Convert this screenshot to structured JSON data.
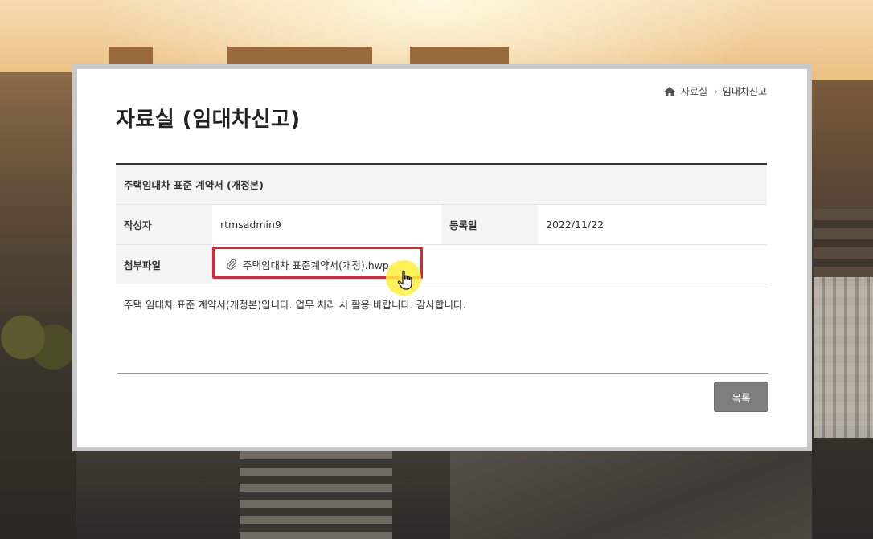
{
  "breadcrumb": {
    "items": [
      "자료실",
      "임대차신고"
    ]
  },
  "page": {
    "title": "자료실 (임대차신고)"
  },
  "post": {
    "subject": "주택임대차 표준 계약서 (개정본)",
    "author_label": "작성자",
    "author": "rtmsadmin9",
    "date_label": "등록일",
    "date": "2022/11/22",
    "attachment_label": "첨부파일",
    "attachment_name": "주택임대차 표준계약서(개정).hwp",
    "body": "주택 임대차 표준 계약서(개정본)입니다. 업무 처리 시 활용 바랍니다. 감사합니다."
  },
  "actions": {
    "list_label": "목록"
  },
  "colors": {
    "highlight": "#e3232f",
    "cursor_glow": "#fff03c",
    "button": "#7e7e7e"
  }
}
